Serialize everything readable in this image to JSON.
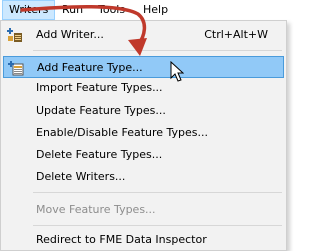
{
  "menubar": {
    "items": [
      {
        "label": "Writers"
      },
      {
        "label": "Run"
      },
      {
        "label": "Tools"
      },
      {
        "label": "Help"
      }
    ]
  },
  "menu": {
    "items": [
      {
        "label": "Add Writer...",
        "shortcut": "Ctrl+Alt+W",
        "icon": "add-writer-icon"
      },
      {
        "label": "Add Feature Type...",
        "icon": "add-feature-type-icon",
        "state": "highlighted"
      },
      {
        "label": "Import Feature Types..."
      },
      {
        "label": "Update Feature Types..."
      },
      {
        "label": "Enable/Disable Feature Types..."
      },
      {
        "label": "Delete Feature Types..."
      },
      {
        "label": "Delete Writers..."
      },
      {
        "label": "Move Feature Types...",
        "state": "disabled"
      },
      {
        "label": "Redirect to FME Data Inspector"
      }
    ]
  },
  "colors": {
    "highlight": "#91c9f7",
    "highlight_border": "#4a9bdb",
    "annotation_arrow": "#c0392b",
    "disabled_text": "#8d8d8d"
  }
}
